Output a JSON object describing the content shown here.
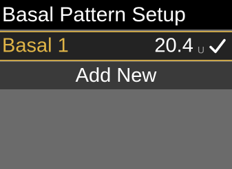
{
  "screen": {
    "title": "Basal Pattern Setup"
  },
  "patterns": [
    {
      "name": "Basal 1",
      "value": "20.4",
      "unit": "U",
      "active_icon": "checkmark-icon"
    }
  ],
  "actions": {
    "add_new_label": "Add New"
  },
  "colors": {
    "title_bg": "#000000",
    "selected_row_bg": "#232323",
    "selected_border": "#c9a54a",
    "selected_text": "#e0b547",
    "add_row_bg": "#3a3a3a",
    "background": "#6b6b6b"
  }
}
